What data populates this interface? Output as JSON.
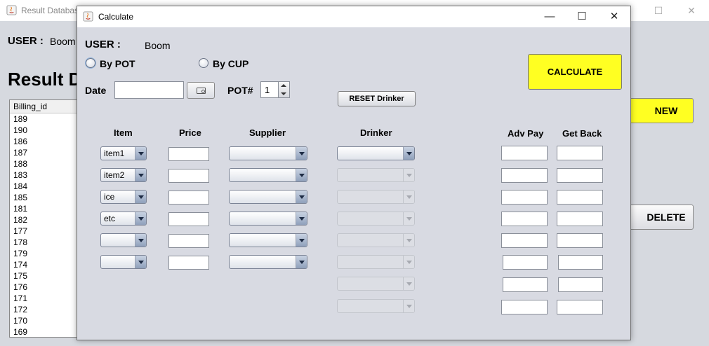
{
  "background_window": {
    "title": "Result Database",
    "user_label": "USER :",
    "user_value": "Boom",
    "heading": "Result Database",
    "table": {
      "header": "Billing_id",
      "rows": [
        "189",
        "190",
        "186",
        "187",
        "188",
        "183",
        "184",
        "185",
        "181",
        "182",
        "177",
        "178",
        "179",
        "174",
        "175",
        "176",
        "171",
        "172",
        "170",
        "169"
      ]
    },
    "new_button": "NEW",
    "delete_button": "DELETE"
  },
  "dialog": {
    "title": "Calculate",
    "user_label": "USER :",
    "user_value": "Boom",
    "radio_by_pot": "By POT",
    "radio_by_cup": "By CUP",
    "date_label": "Date",
    "date_value": "",
    "pot_label": "POT#",
    "pot_value": "1",
    "calculate_button": "CALCULATE",
    "reset_button": "RESET Drinker",
    "columns": {
      "item": "Item",
      "price": "Price",
      "supplier": "Supplier",
      "drinker": "Drinker",
      "adv_pay": "Adv Pay",
      "get_back": "Get Back"
    },
    "items": [
      "item1",
      "item2",
      "ice",
      "etc",
      "",
      ""
    ]
  }
}
